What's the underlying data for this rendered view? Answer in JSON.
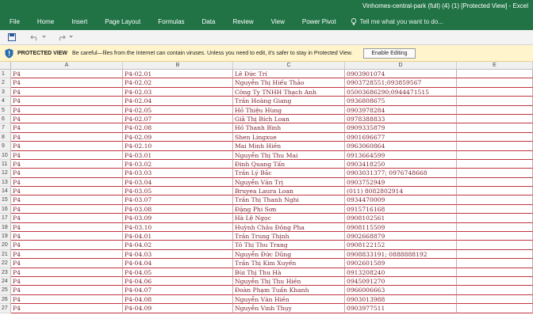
{
  "window": {
    "title": "Vinhomes-central-park (full) (4) (1)  [Protected View] - Excel"
  },
  "ribbon": {
    "tabs": [
      "File",
      "Home",
      "Insert",
      "Page Layout",
      "Formulas",
      "Data",
      "Review",
      "View",
      "Power Pivot"
    ],
    "tell_me": "Tell me what you want to do..."
  },
  "protected_view": {
    "title": "PROTECTED VIEW",
    "message": "Be careful—files from the Internet can contain viruses. Unless you need to edit, it's safer to stay in Protected View.",
    "button": "Enable Editing"
  },
  "columns": [
    "A",
    "B",
    "C",
    "D",
    "E"
  ],
  "rows": [
    {
      "n": "1",
      "a": "P4",
      "b": "P4-02.01",
      "c": "Lê Đức Trí",
      "d": "0903901074"
    },
    {
      "n": "2",
      "a": "P4",
      "b": "P4-02.02",
      "c": "Nguyễn Thị Hiếu Thảo",
      "d": "0903728551;093859567"
    },
    {
      "n": "3",
      "a": "P4",
      "b": "P4-02.03",
      "c": "Công Ty TNHH Thạch Anh",
      "d": "05003686290;0944471515"
    },
    {
      "n": "4",
      "a": "P4",
      "b": "P4-02.04",
      "c": "Trần Hoàng Giang",
      "d": "0936808675"
    },
    {
      "n": "5",
      "a": "P4",
      "b": "P4-02.05",
      "c": "Hồ Thiệu Hùng",
      "d": "0903978284"
    },
    {
      "n": "6",
      "a": "P4",
      "b": "P4-02.07",
      "c": "Giã Thị Bích Loan",
      "d": "0978388833"
    },
    {
      "n": "7",
      "a": "P4",
      "b": "P4-02.08",
      "c": "Hồ Thanh Bình",
      "d": "0909335879"
    },
    {
      "n": "8",
      "a": "P4",
      "b": "P4-02.09",
      "c": "Shen Lingxue",
      "d": "0901696677"
    },
    {
      "n": "9",
      "a": "P4",
      "b": "P4-02.10",
      "c": "Mai Minh Hiền",
      "d": "0963060864"
    },
    {
      "n": "10",
      "a": "P4",
      "b": "P4-03.01",
      "c": "Nguyễn Thị Thu Mai",
      "d": "0913664599"
    },
    {
      "n": "11",
      "a": "P4",
      "b": "P4-03.02",
      "c": "Đinh Quang Tấn",
      "d": "0903418250"
    },
    {
      "n": "12",
      "a": "P4",
      "b": "P4-03.03",
      "c": "Trần Lý Bắc",
      "d": "0903031377; 0976748668"
    },
    {
      "n": "13",
      "a": "P4",
      "b": "P4-03.04",
      "c": "Nguyễn Văn Trị",
      "d": "0903752949"
    },
    {
      "n": "14",
      "a": "P4",
      "b": "P4-03.05",
      "c": "Bruyea Laura Loan",
      "d": "(011) 8082802914"
    },
    {
      "n": "15",
      "a": "P4",
      "b": "P4-03.07",
      "c": "Trần Thị Thanh Nghi",
      "d": "0934470009"
    },
    {
      "n": "16",
      "a": "P4",
      "b": "P4-03.08",
      "c": "Đặng Phi Sơn",
      "d": "0915716168"
    },
    {
      "n": "17",
      "a": "P4",
      "b": "P4-03.09",
      "c": "Hà Lệ Ngọc",
      "d": "0908102561"
    },
    {
      "n": "18",
      "a": "P4",
      "b": "P4-03.10",
      "c": "Huỳnh Châu Đông Pha",
      "d": "0908115509"
    },
    {
      "n": "19",
      "a": "P4",
      "b": "P4-04.01",
      "c": "Trần Trung Thịnh",
      "d": "0902668879"
    },
    {
      "n": "20",
      "a": "P4",
      "b": "P4-04.02",
      "c": "Tô Thị Thu Trang",
      "d": "0908122152"
    },
    {
      "n": "21",
      "a": "P4",
      "b": "P4-04.03",
      "c": "Nguyễn Đức Dũng",
      "d": "0908833191; 0888888192"
    },
    {
      "n": "22",
      "a": "P4",
      "b": "P4-04.04",
      "c": "Trần Thị Kim Xuyến",
      "d": "0902601589"
    },
    {
      "n": "23",
      "a": "P4",
      "b": "P4-04.05",
      "c": "Bùi Thị Thu Hà",
      "d": "0913208240"
    },
    {
      "n": "24",
      "a": "P4",
      "b": "P4-04.06",
      "c": "Nguyễn Thị Thu Hiền",
      "d": "0945091270"
    },
    {
      "n": "25",
      "a": "P4",
      "b": "P4-04.07",
      "c": "Đoàn Phạm Tuấn Khanh",
      "d": "0966006663"
    },
    {
      "n": "26",
      "a": "P4",
      "b": "P4-04.08",
      "c": "Nguyễn Văn Hiền",
      "d": "0903013988"
    },
    {
      "n": "27",
      "a": "P4",
      "b": "P4-04.09",
      "c": "Nguyễn Vinh Thụy",
      "d": "0903977511"
    }
  ]
}
